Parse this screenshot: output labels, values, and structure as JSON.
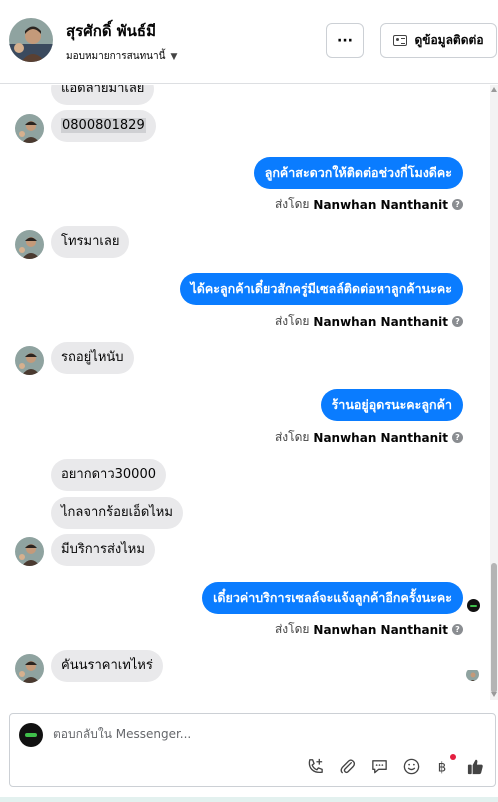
{
  "header": {
    "contact_name": "สุรศักดิ์ พันธ์มี",
    "assign_label": "มอบหมายการสนทนานี้",
    "more_label": "···",
    "contact_info_label": "ดูข้อมูลติดต่อ"
  },
  "messages": {
    "m1": "แอดลายมาเลย",
    "m2": "0800801829",
    "m3": "ลูกค้าสะดวกให้ติดต่อช่วงกี่โมงดีคะ",
    "m4": "โทรมาเลย",
    "m5": "ได้คะลูกค้าเดี๋ยวสักครู่มีเซลล์ติดต่อหาลูกค้านะคะ",
    "m6": "รถอยู่ไหนับ",
    "m7": "ร้านอยู่อุดรนะคะลูกค้า",
    "m8": "อยากดาว30000",
    "m9": "ไกลจากร้อยเอ็ดไหม",
    "m10": "มีบริการส่งไหม",
    "m11": "เดี๋ยวค่าบริการเซลล์จะแจ้งลูกค้าอีกครั้งนะคะ",
    "m12": "คันนราคาเทไหร่"
  },
  "sent_by": {
    "prefix": "ส่งโดย",
    "agent": "Nanwhan Nanthanit",
    "help": "?"
  },
  "composer": {
    "placeholder": "ตอบกลับใน Messenger..."
  },
  "colors": {
    "outgoing_bubble": "#0a7cff",
    "incoming_bubble": "#e9e9eb",
    "notification_dot": "#e41e3f"
  },
  "icons": [
    "phone-add-icon",
    "paperclip-icon",
    "saved-reply-icon",
    "emoji-icon",
    "payment-icon",
    "thumbs-up-icon"
  ]
}
